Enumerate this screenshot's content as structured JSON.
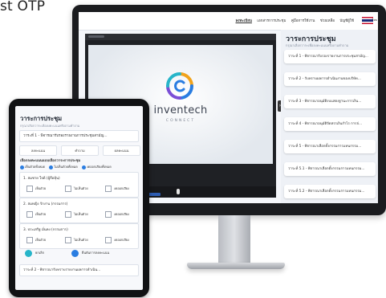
{
  "caption": "st OTP",
  "monitor": {
    "nav_items": [
      "ลงทะเบียน",
      "เอกสารการประชุม",
      "คู่มือการใช้งาน",
      "ช่วยเหลือ",
      "บัญชีผู้ใช้",
      "ไทย"
    ],
    "video": {
      "brand": "inventech",
      "brand_sub": "CONNECT"
    },
    "panel": {
      "title": "วาระการประชุม",
      "subtitle": "กรุณาเลือกวาระเพื่อลงคะแนนหรือถามคำถาม",
      "items": [
        "วาระที่ 1 - พิจารณารับรองรายงานการประชุมสามัญ...",
        "วาระที่ 2 - รับทราบผลการดำเนินงานของบริษัท...",
        "วาระที่ 3 - พิจารณาอนุมัติงบแสดงฐานะการเงิน...",
        "วาระที่ 4 - พิจารณาอนุมัติจัดสรรเงินกำไร การจ่...",
        "วาระที่ 5 - พิจารณาเลือกตั้งกรรมการแทนกรรม...",
        "วาระที่ 5.1 - พิจารณาเลือกตั้งกรรมการแทนกรรม...",
        "วาระที่ 5.2 - พิจารณาเลือกตั้งกรรมการแทนกรรม..."
      ]
    }
  },
  "tablet": {
    "title": "วาระการประชุม",
    "subtitle": "กรุณาเลือกวาระเพื่อลงคะแนนหรือถามคำถาม",
    "agenda": "วาระที่ 1 - พิจารณารับรองรายงานการประชุมสามัญ...",
    "tabs": [
      "ลงคะแนน",
      "คำถาม",
      "ผลคะแนน"
    ],
    "vote_mode_label": "เลือกลงคะแนนแบบเลือกวาระการประชุม",
    "vote_modes": [
      "เห็นด้วยทั้งหมด",
      "ไม่เห็นด้วยทั้งหมด",
      "งดออกเสียงทั้งหมด"
    ],
    "candidates": [
      {
        "name": "1. สมชาย ใจดี (ผู้ถือหุ้น)"
      },
      {
        "name": "2. สมหญิง รักงาน (กรรมการ)"
      },
      {
        "name": "3. ประเสริฐ มั่นคง (กรรมการ)"
      }
    ],
    "options": [
      "เห็นด้วย",
      "ไม่เห็นด้วย",
      "งดออกเสียง"
    ],
    "buttons": {
      "cancel": "ยกเลิก",
      "submit": "ยืนยันการลงคะแนน"
    },
    "next_agenda": "วาระที่ 2 - พิจารณารับทราบรายงานผลการดำเนิน..."
  },
  "colors": {
    "accent": "#2a7de1",
    "brand_orange": "#f2a31b"
  }
}
